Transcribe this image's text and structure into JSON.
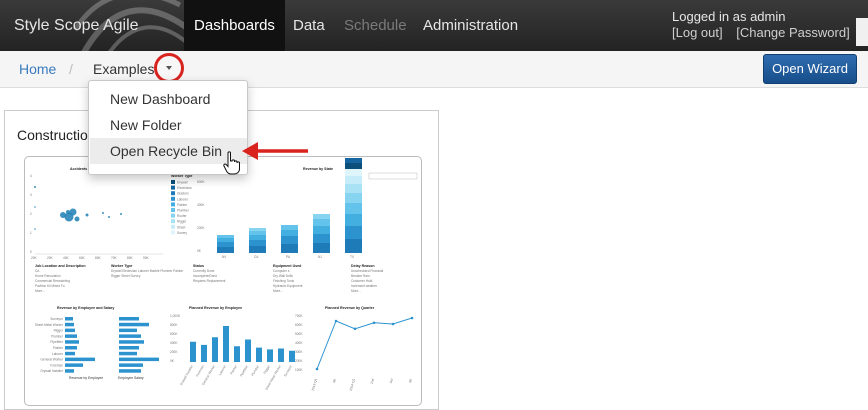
{
  "topnav": {
    "brand": "Style Scope Agile Edition",
    "items": [
      {
        "label": "Dashboards",
        "state": "active"
      },
      {
        "label": "Data",
        "state": "normal"
      },
      {
        "label": "Schedule",
        "state": "disabled"
      },
      {
        "label": "Administration",
        "state": "normal"
      }
    ],
    "user": {
      "logged_in": "Logged in as admin",
      "logout": "[Log out]",
      "change_password": "[Change Password]"
    }
  },
  "breadcrumb": {
    "home": "Home",
    "separator": "/",
    "current": "Examples",
    "caret_icon": "caret-down-icon"
  },
  "toolbar": {
    "open_wizard": "Open Wizard"
  },
  "dropdown": {
    "items": [
      "New Dashboard",
      "New Folder",
      "Open Recycle Bin"
    ],
    "hovered": "Open Recycle Bin"
  },
  "card": {
    "title": "Construction",
    "thumbnail": {
      "accidents": {
        "title": "Accidents",
        "y_ticks": [
          "4",
          "3",
          "2",
          "1",
          "0"
        ],
        "x_ticks": [
          "20K",
          "20K",
          "40K",
          "60K",
          "80K",
          "70K",
          "80K",
          "90K"
        ],
        "legend_title": "Worker Type",
        "legend": [
          "Drywall",
          "Electrician",
          "Glaziers",
          "Laborer",
          "Painter",
          "Plumber",
          "Roofer",
          "Rigger",
          "Sheet",
          "Survey"
        ]
      },
      "revenue_by_state": {
        "title": "Revenue by State",
        "states": [
          "NV",
          "CA",
          "PA",
          "NJ",
          "TX"
        ],
        "y_ticks": [
          "600K",
          "400K",
          "200K",
          "0K"
        ]
      },
      "filters": [
        {
          "title": "Job Location and Description",
          "items": [
            "CA",
            "Home Renovation",
            "Commercial Remodeling",
            "Pavilion 60 Mixed Fo",
            "More..."
          ]
        },
        {
          "title": "Worker Type",
          "items": [
            "Drywall Electrician Laborer Marble Plumber Painter",
            "Rigger Sheet Survey"
          ]
        },
        {
          "title": "Status",
          "items": [
            "Currently Done",
            "Incomplete/Done",
            "Requires Replacement"
          ]
        },
        {
          "title": "Equipment Used",
          "items": [
            "Computer s",
            "Dry Wall Drills",
            "Finishing Tools",
            "Hydraulic Equipment",
            "More..."
          ]
        },
        {
          "title": "Delay Reason",
          "items": [
            "Unscheduled Financial",
            "Breaker Rain",
            "Customer Hold",
            "Inclement weather",
            "More..."
          ]
        }
      ],
      "emp_salary": {
        "title": "Revenue by Employee and Salary",
        "roles": [
          "Surveyor",
          "Sheet Metal Worker",
          "Rigger",
          "Plumber",
          "Pipefitter",
          "Painter",
          "Laborer",
          "General Worker",
          "Foreman",
          "Drywall Installer"
        ],
        "x_label_1": "Revenue by Employee",
        "x_label_2": "Employee Salary"
      },
      "planned_by_employee": {
        "title": "Planned Revenue by Employee",
        "y_ticks": [
          "1,000K",
          "800K",
          "600K",
          "400K",
          "200K",
          "0K"
        ],
        "x_ticks": [
          "Drywall Installer",
          "Foreman",
          "General Worker",
          "Laborer",
          "Painter",
          "Pipefitter",
          "Plumber",
          "Rigger",
          "Sheet Metal Worker",
          "Surveyor"
        ],
        "values": [
          0.45,
          0.38,
          0.55,
          0.8,
          0.35,
          0.5,
          0.32,
          0.28,
          0.3,
          0.25
        ]
      },
      "planned_by_quarter": {
        "title": "Planned Revenue by Quarter",
        "y_ticks": [
          "700K",
          "600K",
          "500K",
          "400K",
          "300K",
          "200K",
          "100K"
        ],
        "x_ticks": [
          "2013-Q4",
          "4th",
          "2014-Q1",
          "2nd",
          "3rd",
          "4th"
        ],
        "values": [
          0.05,
          0.85,
          0.72,
          0.82,
          0.8,
          0.9
        ]
      }
    }
  }
}
